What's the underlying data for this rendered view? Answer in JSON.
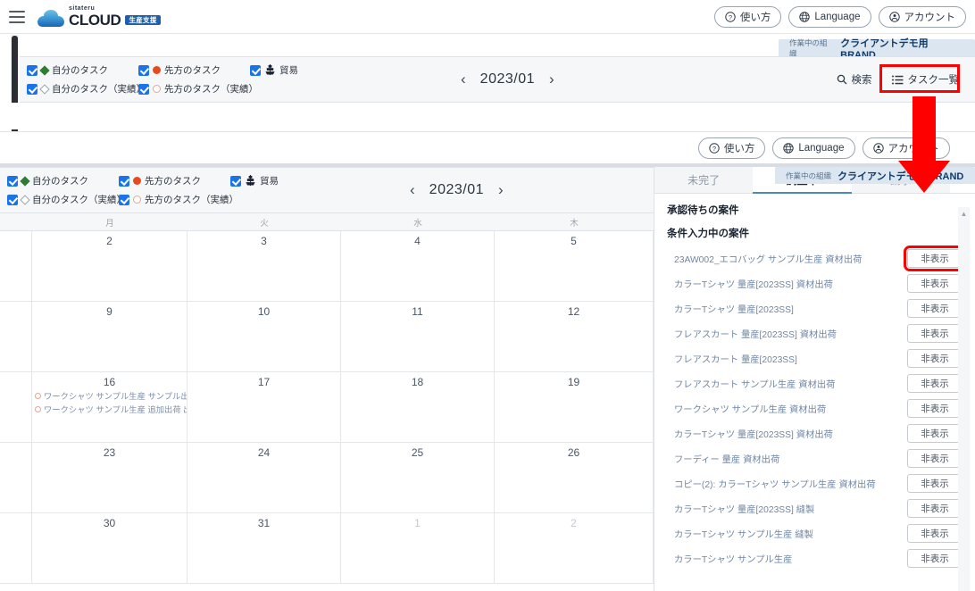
{
  "app": {
    "logo_sub": "sitateru",
    "logo_main": "CLOUD",
    "logo_badge": "生産支援"
  },
  "topbar": {
    "help_label": "使い方",
    "language_label": "Language",
    "account_label": "アカウント"
  },
  "org_ribbon": {
    "label": "作業中の組織",
    "value": "クライアントデモ用 BRAND"
  },
  "legend": {
    "col1": [
      {
        "label": "自分のタスク",
        "marker": "diamond-filled-green"
      },
      {
        "label": "自分のタスク（実績）",
        "marker": "diamond-outline-gray"
      }
    ],
    "col2": [
      {
        "label": "先方のタスク",
        "marker": "circle-filled-orange"
      },
      {
        "label": "先方のタスク（実績）",
        "marker": "circle-outline-orange"
      }
    ],
    "col3": [
      {
        "label": "貿易",
        "marker": "trade-icon"
      }
    ]
  },
  "month_nav": {
    "prev": "‹",
    "label": "2023/01",
    "next": "›"
  },
  "right_actions": {
    "search_label": "検索",
    "tasklist_label": "タスク一覧"
  },
  "calendar": {
    "day_headers": [
      "",
      "月",
      "火",
      "水",
      "木"
    ],
    "weeks": [
      {
        "days": [
          {
            "num": "",
            "muted": false,
            "tasks": []
          },
          {
            "num": "2",
            "muted": false,
            "tasks": []
          },
          {
            "num": "3",
            "muted": false,
            "tasks": []
          },
          {
            "num": "4",
            "muted": false,
            "tasks": []
          },
          {
            "num": "5",
            "muted": false,
            "tasks": []
          }
        ]
      },
      {
        "days": [
          {
            "num": "",
            "muted": false,
            "tasks": []
          },
          {
            "num": "9",
            "muted": false,
            "tasks": []
          },
          {
            "num": "10",
            "muted": false,
            "tasks": []
          },
          {
            "num": "11",
            "muted": false,
            "tasks": []
          },
          {
            "num": "12",
            "muted": false,
            "tasks": []
          }
        ]
      },
      {
        "days": [
          {
            "num": "",
            "muted": false,
            "tasks": []
          },
          {
            "num": "16",
            "muted": false,
            "tasks": [
              "ワークシャツ サンプル生産 サンプル出",
              "ワークシャツ サンプル生産 追加出荷 出"
            ]
          },
          {
            "num": "17",
            "muted": false,
            "tasks": []
          },
          {
            "num": "18",
            "muted": false,
            "tasks": []
          },
          {
            "num": "19",
            "muted": false,
            "tasks": []
          }
        ]
      },
      {
        "days": [
          {
            "num": "",
            "muted": false,
            "tasks": []
          },
          {
            "num": "23",
            "muted": false,
            "tasks": []
          },
          {
            "num": "24",
            "muted": false,
            "tasks": []
          },
          {
            "num": "25",
            "muted": false,
            "tasks": []
          },
          {
            "num": "26",
            "muted": false,
            "tasks": []
          }
        ]
      },
      {
        "days": [
          {
            "num": "",
            "muted": false,
            "tasks": []
          },
          {
            "num": "30",
            "muted": false,
            "tasks": []
          },
          {
            "num": "31",
            "muted": false,
            "tasks": []
          },
          {
            "num": "1",
            "muted": true,
            "tasks": []
          },
          {
            "num": "2",
            "muted": true,
            "tasks": []
          }
        ]
      }
    ]
  },
  "task_panel": {
    "tabs": [
      {
        "label": "未完了",
        "active": false
      },
      {
        "label": "調整中",
        "active": true
      },
      {
        "label": "請求",
        "active": false
      }
    ],
    "close_icon": "×",
    "sections": [
      {
        "title": "承認待ちの案件",
        "items": []
      },
      {
        "title": "条件入力中の案件",
        "items": [
          {
            "label": "23AW002_エコバッグ サンプル生産 資材出荷",
            "button": "非表示",
            "highlighted": true
          },
          {
            "label": "カラーTシャツ 量産[2023SS] 資材出荷",
            "button": "非表示",
            "highlighted": false
          },
          {
            "label": "カラーTシャツ 量産[2023SS]",
            "button": "非表示",
            "highlighted": false
          },
          {
            "label": "フレアスカート 量産[2023SS] 資材出荷",
            "button": "非表示",
            "highlighted": false
          },
          {
            "label": "フレアスカート 量産[2023SS]",
            "button": "非表示",
            "highlighted": false
          },
          {
            "label": "フレアスカート サンプル生産 資材出荷",
            "button": "非表示",
            "highlighted": false
          },
          {
            "label": "ワークシャツ サンプル生産 資材出荷",
            "button": "非表示",
            "highlighted": false
          },
          {
            "label": "カラーTシャツ 量産[2023SS] 資材出荷",
            "button": "非表示",
            "highlighted": false
          },
          {
            "label": "フーディー 量産 資材出荷",
            "button": "非表示",
            "highlighted": false
          },
          {
            "label": "コピー(2): カラーTシャツ サンプル生産 資材出荷",
            "button": "非表示",
            "highlighted": false
          },
          {
            "label": "カラーTシャツ 量産[2023SS] 縫製",
            "button": "非表示",
            "highlighted": false
          },
          {
            "label": "カラーTシャツ サンプル生産 縫製",
            "button": "非表示",
            "highlighted": false
          },
          {
            "label": "カラーTシャツ サンプル生産",
            "button": "非表示",
            "highlighted": false
          }
        ]
      }
    ]
  },
  "colors": {
    "accent_blue": "#1a73e8",
    "tab_underline": "#4a88c7",
    "annotation_red": "#ff0000",
    "task_green": "#2e7d32",
    "task_orange": "#e8491d"
  }
}
